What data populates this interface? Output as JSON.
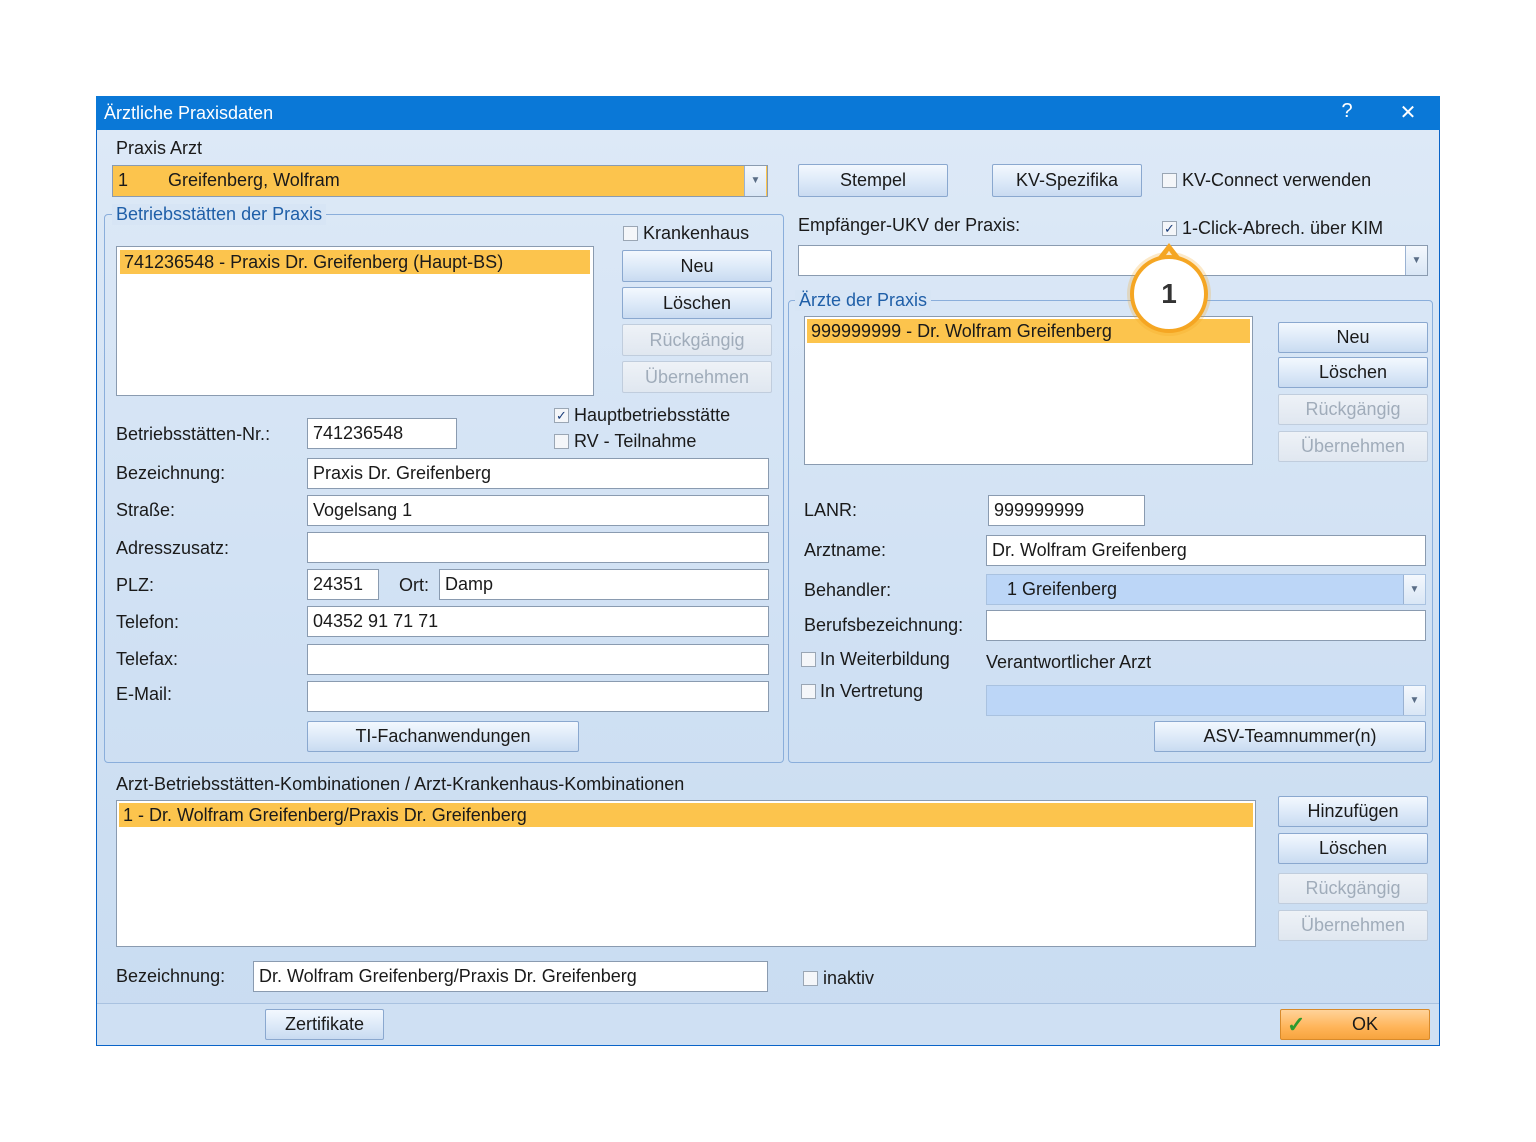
{
  "window": {
    "title": "Ärztliche Praxisdaten",
    "help": "?",
    "close": "✕"
  },
  "praxis": {
    "section_label": "Praxis  Arzt",
    "selected": "1        Greifenberg, Wolfram",
    "stempel": "Stempel",
    "kv_spezifika": "KV-Spezifika",
    "kv_connect": "KV-Connect verwenden"
  },
  "betriebsstaetten": {
    "group_title": "Betriebsstätten der Praxis",
    "krankenhaus": "Krankenhaus",
    "list": [
      "741236548 - Praxis Dr. Greifenberg (Haupt-BS)"
    ],
    "buttons": {
      "neu": "Neu",
      "loeschen": "Löschen",
      "rueckgaengig": "Rückgängig",
      "uebernehmen": "Übernehmen"
    },
    "hauptbetriebsstaette": "Hauptbetriebsstätte",
    "rv_teilnahme": "RV - Teilnahme",
    "fields": {
      "nr_label": "Betriebsstätten-Nr.:",
      "nr": "741236548",
      "bezeichnung_label": "Bezeichnung:",
      "bezeichnung": "Praxis Dr. Greifenberg",
      "strasse_label": "Straße:",
      "strasse": "Vogelsang 1",
      "adresszusatz_label": "Adresszusatz:",
      "adresszusatz": "",
      "plz_label": "PLZ:",
      "plz": "24351",
      "ort_label": "Ort:",
      "ort": "Damp",
      "telefon_label": "Telefon:",
      "telefon": "04352 91 71 71",
      "telefax_label": "Telefax:",
      "telefax": "",
      "email_label": "E-Mail:",
      "email": ""
    },
    "ti_button": "TI-Fachanwendungen"
  },
  "empfaenger": {
    "label": "Empfänger-UKV der Praxis:",
    "one_click": "1-Click-Abrech. über KIM",
    "value": ""
  },
  "callout": "1",
  "aerzte": {
    "group_title": "Ärzte der Praxis",
    "list": [
      "999999999 - Dr. Wolfram Greifenberg"
    ],
    "buttons": {
      "neu": "Neu",
      "loeschen": "Löschen",
      "rueckgaengig": "Rückgängig",
      "uebernehmen": "Übernehmen"
    },
    "lanr_label": "LANR:",
    "lanr": "999999999",
    "arztname_label": "Arztname:",
    "arztname": "Dr. Wolfram Greifenberg",
    "behandler_label": "Behandler:",
    "behandler": "1 Greifenberg",
    "beruf_label": "Berufsbezeichnung:",
    "beruf": "",
    "weiterbildung": "In Weiterbildung",
    "vertretung": "In Vertretung",
    "verantwortlich_label": "Verantwortlicher Arzt",
    "verantwortlich": "",
    "asv_button": "ASV-Teamnummer(n)"
  },
  "kombinationen": {
    "label": "Arzt-Betriebsstätten-Kombinationen / Arzt-Krankenhaus-Kombinationen",
    "list": [
      "1 - Dr. Wolfram Greifenberg/Praxis Dr. Greifenberg"
    ],
    "buttons": {
      "hinzufuegen": "Hinzufügen",
      "loeschen": "Löschen",
      "rueckgaengig": "Rückgängig",
      "uebernehmen": "Übernehmen"
    },
    "bezeichnung_label": "Bezeichnung:",
    "bezeichnung": "Dr. Wolfram Greifenberg/Praxis Dr. Greifenberg",
    "inaktiv": "inaktiv"
  },
  "footer": {
    "zertifikate": "Zertifikate",
    "ok": "OK"
  },
  "colors": {
    "title_bar": "#0a78d7",
    "selection": "#fcc44d",
    "accent_orange": "#f5a623"
  }
}
